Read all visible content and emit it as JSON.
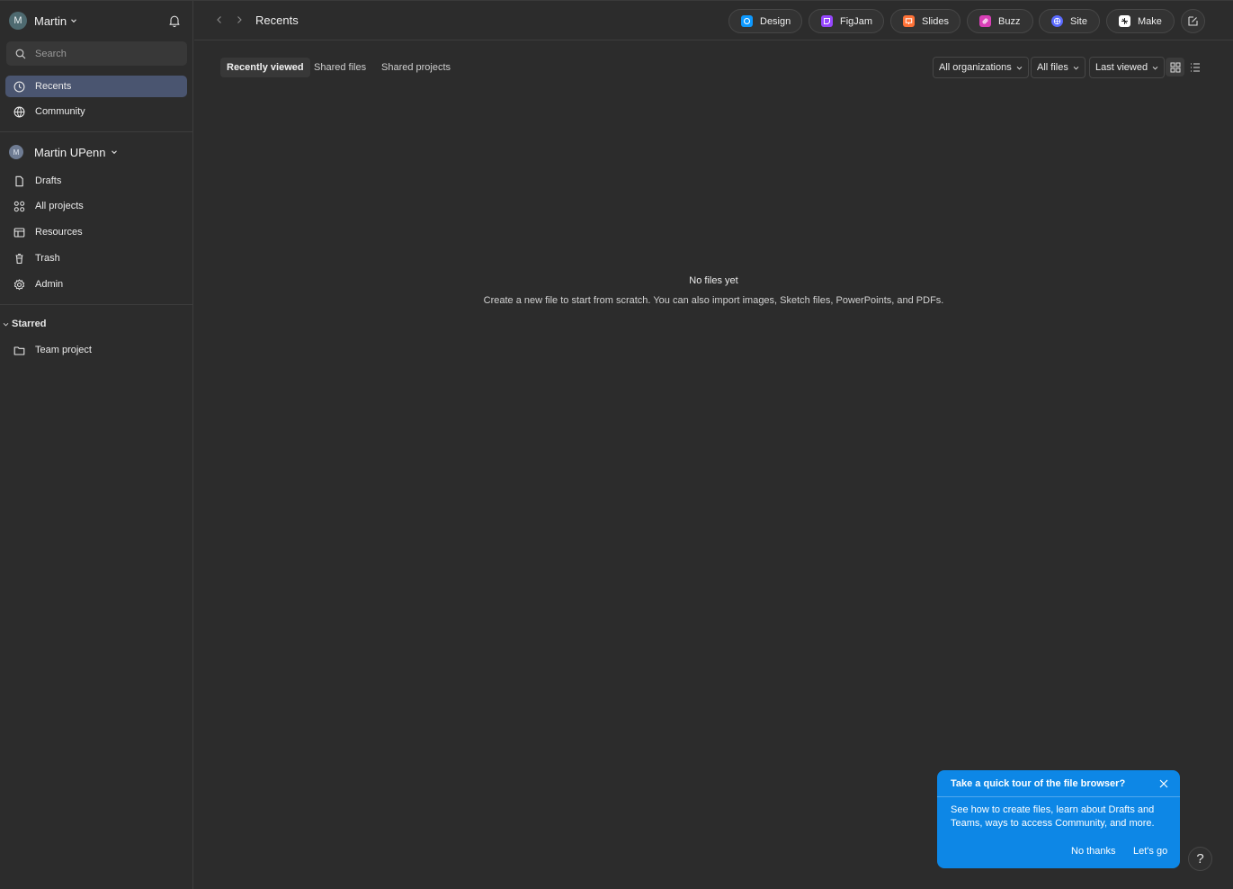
{
  "account": {
    "avatar_letter": "M",
    "name": "Martin"
  },
  "search": {
    "placeholder": "Search"
  },
  "nav_top": [
    {
      "label": "Recents",
      "icon": "clock-icon"
    },
    {
      "label": "Community",
      "icon": "globe-icon"
    }
  ],
  "team": {
    "avatar_letter": "M",
    "name": "Martin UPenn"
  },
  "nav_team": [
    {
      "label": "Drafts",
      "icon": "file-icon"
    },
    {
      "label": "All projects",
      "icon": "grid-icon"
    },
    {
      "label": "Resources",
      "icon": "resources-icon"
    },
    {
      "label": "Trash",
      "icon": "trash-icon"
    },
    {
      "label": "Admin",
      "icon": "gear-icon"
    }
  ],
  "starred": {
    "label": "Starred",
    "items": [
      {
        "label": "Team project",
        "icon": "folder-icon"
      }
    ]
  },
  "topbar": {
    "breadcrumb": "Recents",
    "products": [
      {
        "label": "Design",
        "color": "#0d99ff"
      },
      {
        "label": "FigJam",
        "color": "#9747ff"
      },
      {
        "label": "Slides",
        "color": "#ff7237"
      },
      {
        "label": "Buzz",
        "color": "#d93fb7"
      },
      {
        "label": "Site",
        "color": "#5b6bff"
      },
      {
        "label": "Make",
        "color": "#ffffff"
      }
    ]
  },
  "tabs": [
    {
      "label": "Recently viewed",
      "active": true
    },
    {
      "label": "Shared files",
      "active": false
    },
    {
      "label": "Shared projects",
      "active": false
    }
  ],
  "filters": {
    "org": "All organizations",
    "files": "All files",
    "sort": "Last viewed"
  },
  "empty_state": {
    "title": "No files yet",
    "description": "Create a new file to start from scratch. You can also import images, Sketch files, PowerPoints, and PDFs."
  },
  "tour": {
    "title": "Take a quick tour of the file browser?",
    "body": "See how to create files, learn about Drafts and Teams, ways to access Community, and more.",
    "decline_label": "No thanks",
    "accept_label": "Let's go"
  },
  "help": {
    "label": "?"
  },
  "colors": {
    "background": "#2c2c2c",
    "active_nav": "#4a5570",
    "tour_blue": "#0d87e6"
  }
}
